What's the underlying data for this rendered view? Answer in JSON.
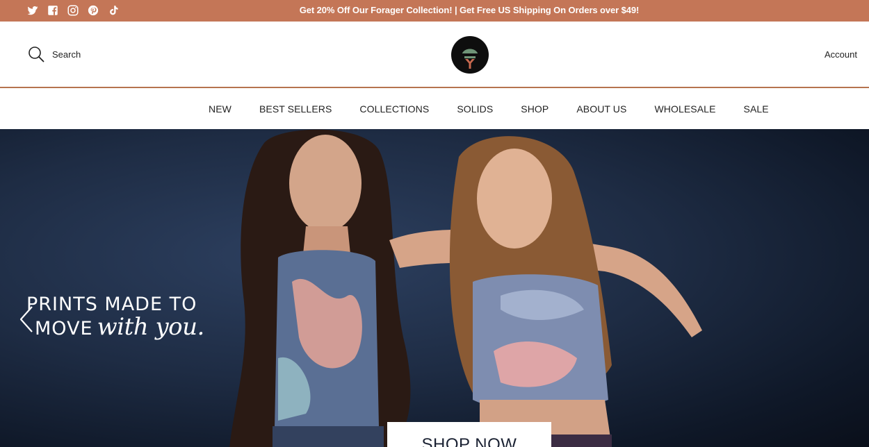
{
  "announcement": {
    "text": "Get 20% Off Our Forager Collection! | Get Free US Shipping On Orders over $49!",
    "social_icons": [
      "twitter-icon",
      "facebook-icon",
      "instagram-icon",
      "pinterest-icon",
      "tiktok-icon"
    ]
  },
  "header": {
    "search_label": "Search",
    "account_label": "Account",
    "logo_icon": "brand-logo"
  },
  "nav": {
    "items": [
      {
        "label": "NEW"
      },
      {
        "label": "BEST SELLERS"
      },
      {
        "label": "COLLECTIONS"
      },
      {
        "label": "SOLIDS"
      },
      {
        "label": "SHOP"
      },
      {
        "label": "ABOUT US"
      },
      {
        "label": "WHOLESALE"
      },
      {
        "label": "SALE"
      }
    ]
  },
  "hero": {
    "headline_line1": "PRINTS MADE TO",
    "headline_line2a": "MOVE",
    "headline_line2b": "with you.",
    "cta_label": "SHOP NOW"
  },
  "colors": {
    "announcement_bg": "#c47657",
    "header_border": "#b5734f",
    "hero_bg": "#1e2c44"
  }
}
